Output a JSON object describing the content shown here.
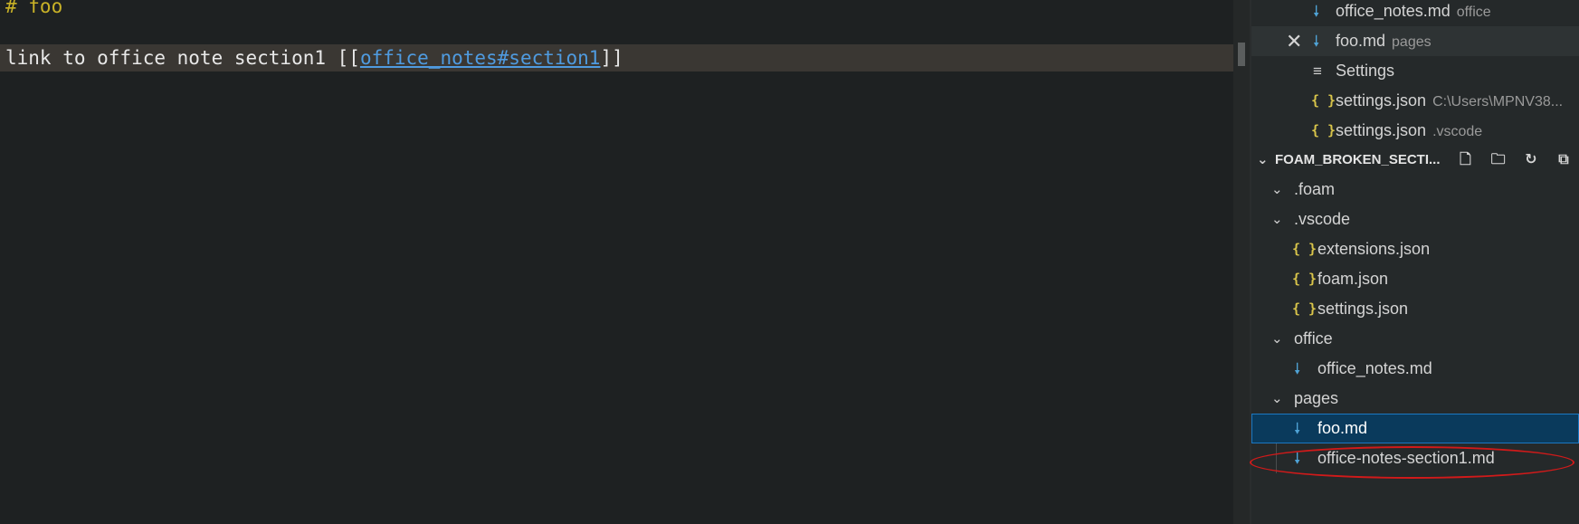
{
  "editor": {
    "line1": "# foo",
    "line2_prefix": "link to office note section1 [[",
    "line2_link": "office_notes#section1",
    "line2_suffix": "]]"
  },
  "open_editors": [
    {
      "label": "office_notes.md",
      "desc": "office",
      "icon": "markdown-icon"
    },
    {
      "label": "foo.md",
      "desc": "pages",
      "icon": "markdown-icon",
      "close": "✕"
    },
    {
      "label": "Settings",
      "desc": "",
      "icon": "settings-icon"
    },
    {
      "label": "settings.json",
      "desc": "C:\\Users\\MPNV38...",
      "icon": "json-icon"
    },
    {
      "label": "settings.json",
      "desc": ".vscode",
      "icon": "json-icon"
    }
  ],
  "explorer": {
    "title": "FOAM_BROKEN_SECTI...",
    "actions": [
      "new-file-icon",
      "new-folder-icon",
      "refresh-icon",
      "collapse-all-icon"
    ],
    "tree": [
      {
        "label": ".foam",
        "type": "folder"
      },
      {
        "label": ".vscode",
        "type": "folder"
      },
      {
        "label": "extensions.json",
        "type": "json"
      },
      {
        "label": "foam.json",
        "type": "json"
      },
      {
        "label": "settings.json",
        "type": "json"
      },
      {
        "label": "office",
        "type": "folder"
      },
      {
        "label": "office_notes.md",
        "type": "md"
      },
      {
        "label": "pages",
        "type": "folder"
      },
      {
        "label": "foo.md",
        "type": "md",
        "selected": true
      },
      {
        "label": "office-notes-section1.md",
        "type": "md"
      }
    ]
  },
  "glyphs": {
    "json": "{ }",
    "md": "🠗",
    "chevron": "⌄",
    "settings": "≡"
  },
  "colors": {
    "accent": "#1c78c2",
    "link": "#4f9be0",
    "heading": "#c9b227",
    "annotation": "#d11a1a"
  }
}
